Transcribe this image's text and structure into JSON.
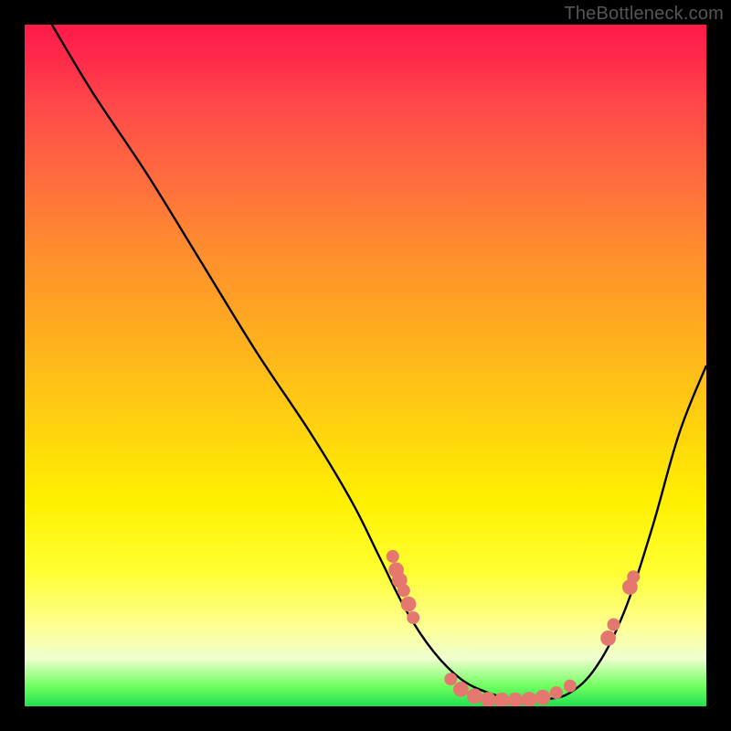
{
  "watermark": "TheBottleneck.com",
  "chart_data": {
    "type": "line",
    "title": "",
    "xlabel": "",
    "ylabel": "",
    "xlim": [
      0,
      100
    ],
    "ylim": [
      0,
      100
    ],
    "series": [
      {
        "name": "curve",
        "x": [
          4,
          10,
          18,
          26,
          34,
          42,
          48,
          52,
          56,
          60,
          64,
          68,
          72,
          76,
          80,
          84,
          88,
          92,
          96,
          100
        ],
        "y": [
          100,
          90,
          78,
          65,
          52,
          40,
          30,
          22,
          14,
          8,
          4,
          2,
          1,
          1,
          2,
          6,
          14,
          26,
          40,
          50
        ]
      }
    ],
    "markers": [
      {
        "name": "dot",
        "x": 54.0,
        "y": 22.0,
        "r": 1.0
      },
      {
        "name": "dot",
        "x": 54.5,
        "y": 20.0,
        "r": 1.2
      },
      {
        "name": "dot",
        "x": 55.0,
        "y": 18.5,
        "r": 1.2
      },
      {
        "name": "dot",
        "x": 55.6,
        "y": 17.0,
        "r": 1.0
      },
      {
        "name": "dot",
        "x": 56.3,
        "y": 15.0,
        "r": 1.2
      },
      {
        "name": "dot",
        "x": 57.0,
        "y": 13.0,
        "r": 1.0
      },
      {
        "name": "dot",
        "x": 62.5,
        "y": 4.0,
        "r": 1.0
      },
      {
        "name": "dot",
        "x": 64.0,
        "y": 2.5,
        "r": 1.2
      },
      {
        "name": "dot",
        "x": 66.0,
        "y": 1.5,
        "r": 1.2
      },
      {
        "name": "dot",
        "x": 68.0,
        "y": 1.0,
        "r": 1.2
      },
      {
        "name": "dot",
        "x": 70.0,
        "y": 0.9,
        "r": 1.2
      },
      {
        "name": "dot",
        "x": 72.0,
        "y": 0.9,
        "r": 1.2
      },
      {
        "name": "dot",
        "x": 74.0,
        "y": 1.0,
        "r": 1.2
      },
      {
        "name": "dot",
        "x": 76.0,
        "y": 1.3,
        "r": 1.2
      },
      {
        "name": "dot",
        "x": 78.0,
        "y": 2.0,
        "r": 1.0
      },
      {
        "name": "dot",
        "x": 80.0,
        "y": 3.0,
        "r": 1.0
      },
      {
        "name": "dot",
        "x": 85.6,
        "y": 10.0,
        "r": 1.2
      },
      {
        "name": "dot",
        "x": 86.4,
        "y": 12.0,
        "r": 1.0
      },
      {
        "name": "dot",
        "x": 88.8,
        "y": 17.5,
        "r": 1.2
      },
      {
        "name": "dot",
        "x": 89.3,
        "y": 19.0,
        "r": 1.0
      }
    ],
    "marker_color": "#e4786e",
    "curve_color": "#000000"
  }
}
